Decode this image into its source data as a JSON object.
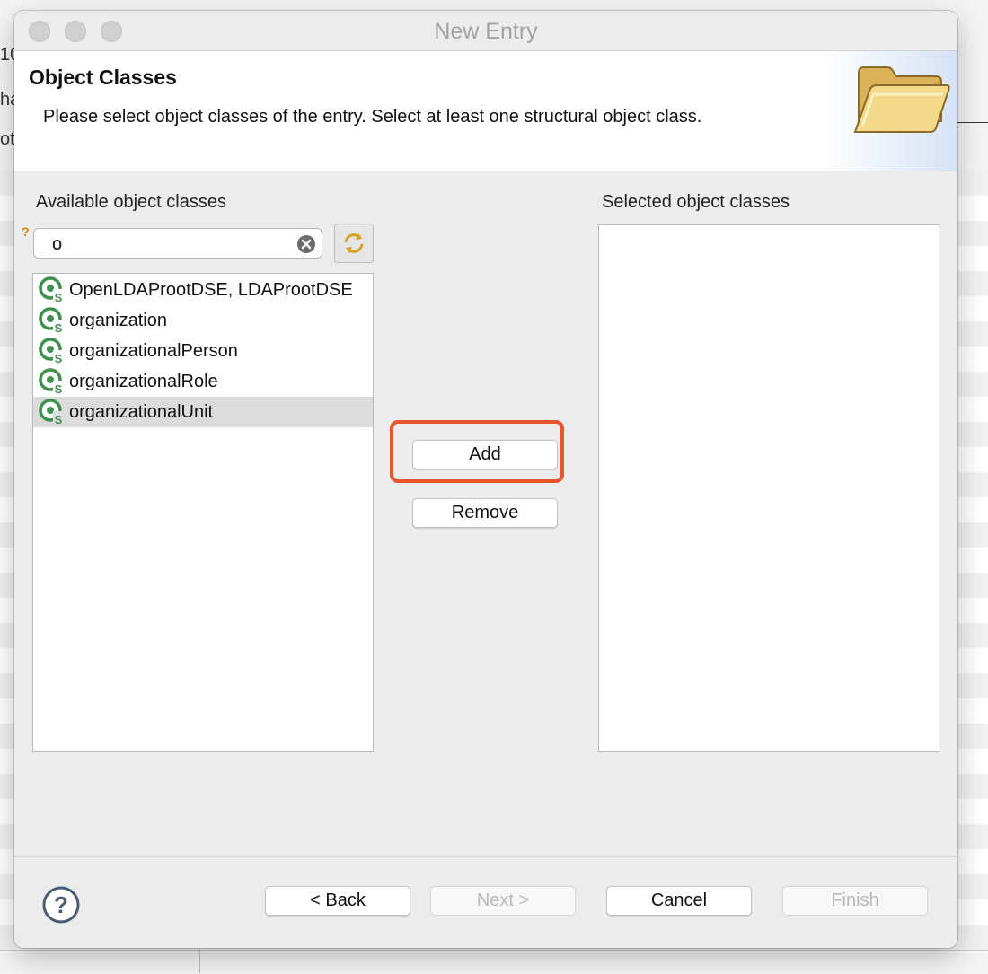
{
  "background": {
    "fragments": [
      "10",
      "ha",
      "ot"
    ]
  },
  "window": {
    "title": "New Entry"
  },
  "header": {
    "title": "Object Classes",
    "description": "Please select object classes of the entry. Select at least one structural object class."
  },
  "available": {
    "label": "Available object classes",
    "filter_value": "o",
    "items": [
      {
        "label": "OpenLDAProotDSE, LDAProotDSE",
        "selected": false
      },
      {
        "label": "organization",
        "selected": false
      },
      {
        "label": "organizationalPerson",
        "selected": false
      },
      {
        "label": "organizationalRole",
        "selected": false
      },
      {
        "label": "organizationalUnit",
        "selected": true
      }
    ]
  },
  "selected": {
    "label": "Selected object classes",
    "items": []
  },
  "actions": {
    "add_label": "Add",
    "remove_label": "Remove"
  },
  "footer": {
    "back_label": "< Back",
    "next_label": "Next >",
    "cancel_label": "Cancel",
    "finish_label": "Finish"
  },
  "colors": {
    "highlight": "#e8562f",
    "icon_green": "#3f8f4f"
  },
  "icons": {
    "object_class": "object-class-icon",
    "folder": "folder-icon",
    "help": "help-icon",
    "clear": "clear-icon",
    "refresh": "refresh-icon"
  }
}
